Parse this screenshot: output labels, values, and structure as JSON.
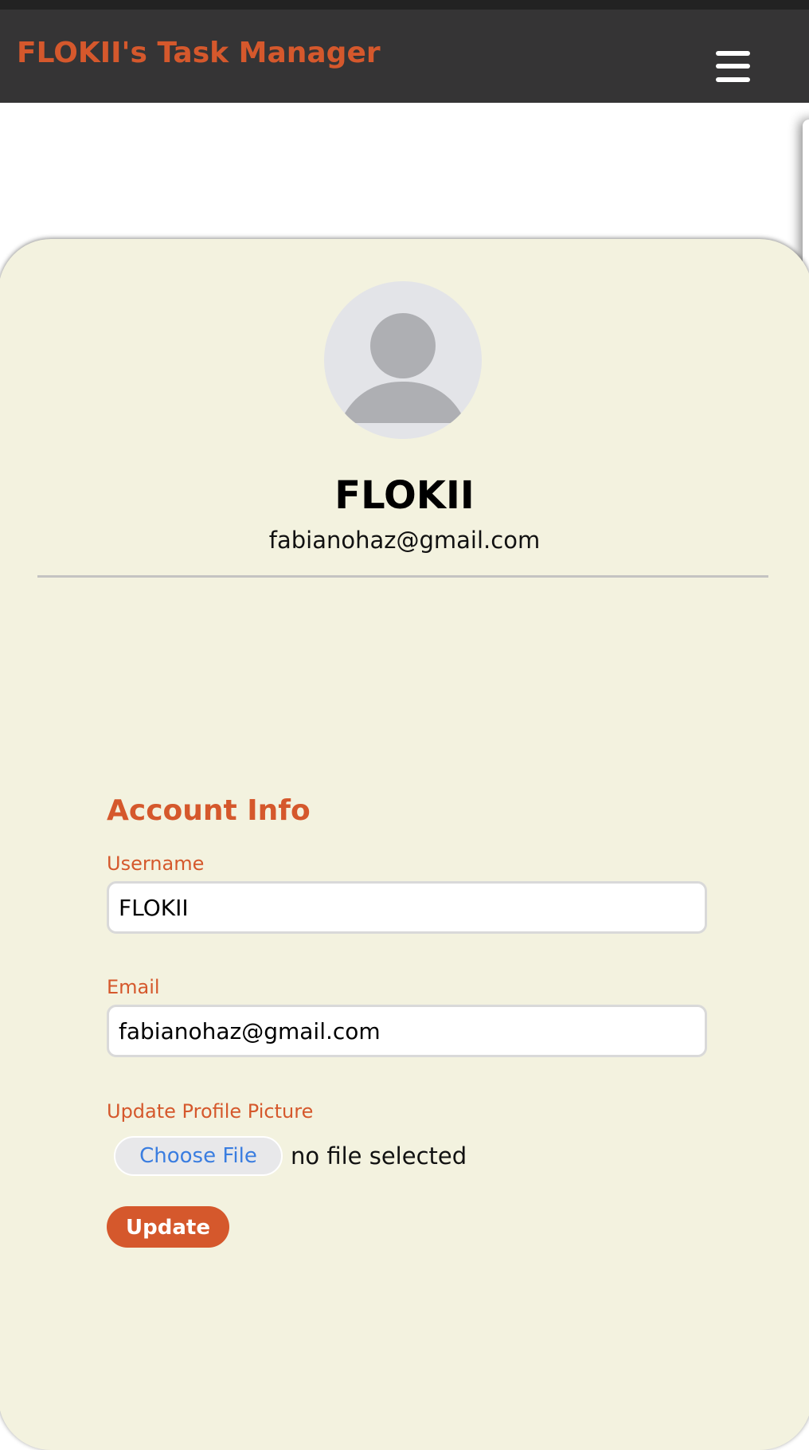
{
  "app": {
    "title": "FLOKII's Task Manager"
  },
  "navbar": {
    "menu_icon": "hamburger-menu-icon"
  },
  "profile": {
    "avatar_icon": "default-user-avatar-icon",
    "name": "FLOKII",
    "email": "fabianohaz@gmail.com"
  },
  "account": {
    "section_title": "Account Info",
    "username_label": "Username",
    "username_value": "FLOKII",
    "email_label": "Email",
    "email_value": "fabianohaz@gmail.com",
    "picture_label": "Update Profile Picture",
    "choose_file_label": "Choose File",
    "file_status": "no file selected",
    "update_label": "Update"
  },
  "colors": {
    "accent": "#d5582c",
    "navbar": "#353435",
    "card_background": "#f3f2df",
    "link_blue": "#3a7de0"
  }
}
